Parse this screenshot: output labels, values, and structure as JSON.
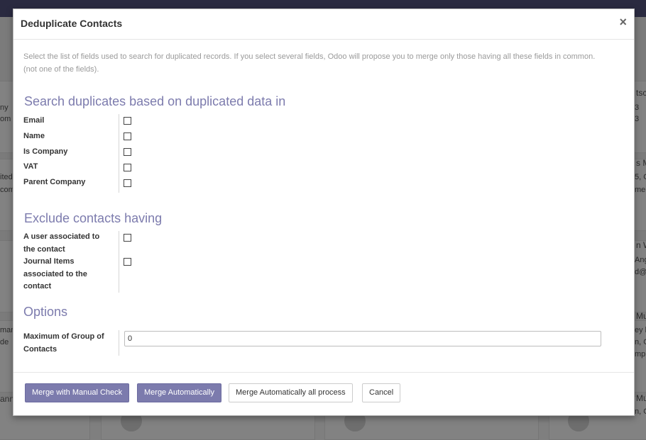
{
  "modal": {
    "title": "Deduplicate Contacts",
    "close_symbol": "×",
    "help_text": "Select the list of fields used to search for duplicated records. If you select several fields, Odoo will propose you to merge only those having all these fields in common. (not one of the fields).",
    "sections": {
      "duplicates": {
        "title": "Search duplicates based on duplicated data in",
        "fields": [
          "Email",
          "Name",
          "Is Company",
          "VAT",
          "Parent Company"
        ]
      },
      "exclude": {
        "title": "Exclude contacts having",
        "fields": [
          "A user associated to the contact",
          "Journal Items associated to the contact"
        ]
      },
      "options": {
        "title": "Options",
        "max_group_label": "Maximum of Group of Contacts",
        "max_group_value": "0"
      }
    },
    "buttons": {
      "manual": "Merge with Manual Check",
      "auto": "Merge Automatically",
      "auto_all": "Merge Automatically all process",
      "cancel": "Cancel"
    }
  },
  "background": {
    "left_fragments": [
      "ny",
      "om",
      "ited",
      "com",
      "man",
      "de",
      "ann"
    ],
    "right_fragments": [
      "tscl",
      "3",
      "3",
      "s M",
      "5, C",
      "mei",
      "n W",
      "Ang",
      "d@n",
      "Mu",
      "ey li",
      "n, G",
      "mple",
      "Mu",
      "n, G"
    ]
  },
  "colors": {
    "accent": "#7c7bad",
    "topbar": "#2a2a40"
  }
}
